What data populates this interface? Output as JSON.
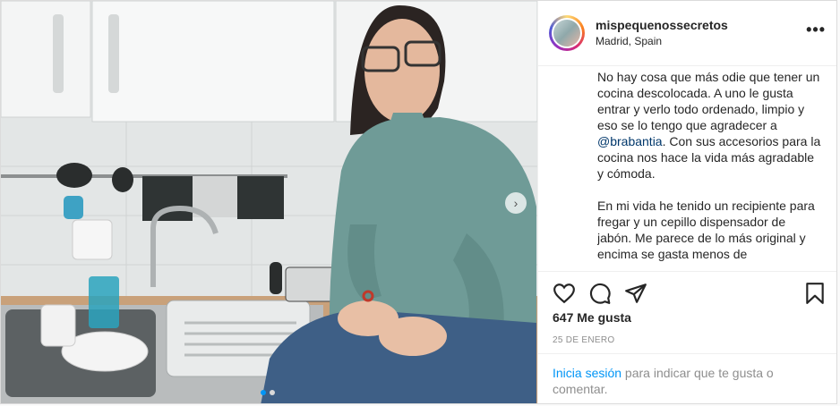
{
  "post": {
    "username": "mispequenossecretos",
    "location": "Madrid, Spain",
    "more_icon": "more-horizontal-icon",
    "caption_p1_before": "No hay cosa que más odie que tener un cocina descolocada. A uno le gusta entrar y verlo todo ordenado, limpio y eso se lo tengo que agradecer a ",
    "caption_mention": "@brabantia",
    "caption_p1_after": ". Con sus accesorios para la cocina nos hace la vida más agradable y cómoda.",
    "caption_p2": "En mi vida he tenido un recipiente para fregar y un cepillo dispensador de jabón. Me parece de lo más original y encima se gasta menos de",
    "likes": "647 Me gusta",
    "date": "25 DE ENERO",
    "login_link": "Inicia sesión",
    "login_text": " para indicar que te gusta o comentar."
  },
  "colors": {
    "link": "#0095f6",
    "mention": "#00376b",
    "sweater": "#6f9b97"
  }
}
